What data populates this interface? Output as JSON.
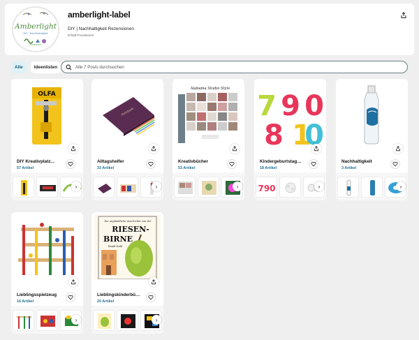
{
  "shop": {
    "name": "amberlight-label",
    "tagline": "DIY | Nachhaltigkeit Rezensionen",
    "subline": "Erhält Provisionen",
    "logo_text": "Amberlight",
    "logo_subtext": "DIY · Nachhaltigkeit"
  },
  "tabs": [
    {
      "label": "Alle",
      "active": true
    },
    {
      "label": "Ideenlisten",
      "active": false
    }
  ],
  "search": {
    "placeholder": "Alle 7 Posts durchsuchen"
  },
  "collections": [
    {
      "title": "DIY Kreativplatz...",
      "count": "57 Artikel"
    },
    {
      "title": "Alltagshelfer",
      "count": "33 Artikel"
    },
    {
      "title": "Kreativbücher",
      "count": "53 Artikel",
      "cover_text": "Alabama Studio Style"
    },
    {
      "title": "Kindergeburtstags...",
      "count": "18 Artikel"
    },
    {
      "title": "Nachhaltigkeit",
      "count": "3 Artikel"
    },
    {
      "title": "Lieblingsspielzeug",
      "count": "16 Artikel"
    },
    {
      "title": "Lieblingskinderbüc...",
      "count": "20 Artikel",
      "cover_text_1": "Die unglaubliche Geschichte von der",
      "cover_text_2": "RIESEN-",
      "cover_text_3": "BIRNE",
      "cover_text_4": "Roald Dahl"
    }
  ],
  "colors": {
    "accent": "#1d6f93",
    "tab_active_bg": "#dff1f7",
    "page_bg": "#efefef"
  },
  "icons": [
    "share-icon",
    "heart-icon",
    "search-icon",
    "chevron-right-icon"
  ]
}
